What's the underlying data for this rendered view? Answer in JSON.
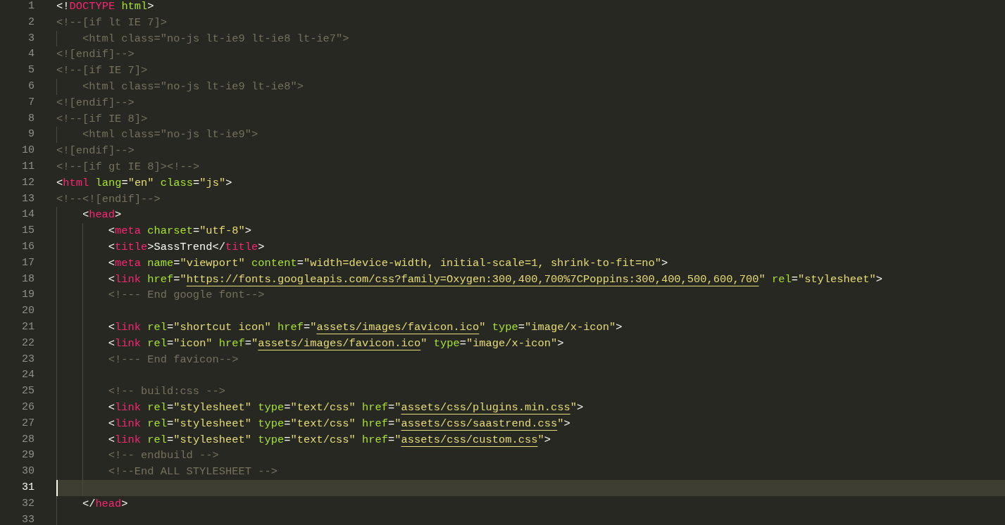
{
  "editor": {
    "lines": [
      {
        "number": "1",
        "current": false,
        "tokens": [
          {
            "kind": "p",
            "text": "<!"
          },
          {
            "kind": "tag",
            "text": "DOCTYPE"
          },
          {
            "kind": "attr",
            "text": " html"
          },
          {
            "kind": "p",
            "text": ">"
          }
        ]
      },
      {
        "number": "2",
        "current": false,
        "tokens": [
          {
            "kind": "cmt",
            "text": "<!--[if lt IE 7]>"
          }
        ],
        "children": [
          {
            "number": "3",
            "current": false,
            "tokens": [
              {
                "kind": "cmt",
                "text": "<html class=\"no-js lt-ie9 lt-ie8 lt-ie7\">"
              }
            ]
          }
        ]
      },
      {
        "number": "4",
        "current": false,
        "tokens": [
          {
            "kind": "cmt",
            "text": "<![endif]-->"
          }
        ]
      },
      {
        "number": "5",
        "current": false,
        "tokens": [
          {
            "kind": "cmt",
            "text": "<!--[if IE 7]>"
          }
        ],
        "children": [
          {
            "number": "6",
            "current": false,
            "tokens": [
              {
                "kind": "cmt",
                "text": "<html class=\"no-js lt-ie9 lt-ie8\">"
              }
            ]
          }
        ]
      },
      {
        "number": "7",
        "current": false,
        "tokens": [
          {
            "kind": "cmt",
            "text": "<![endif]-->"
          }
        ]
      },
      {
        "number": "8",
        "current": false,
        "tokens": [
          {
            "kind": "cmt",
            "text": "<!--[if IE 8]>"
          }
        ],
        "children": [
          {
            "number": "9",
            "current": false,
            "tokens": [
              {
                "kind": "cmt",
                "text": "<html class=\"no-js lt-ie9\">"
              }
            ]
          }
        ]
      },
      {
        "number": "10",
        "current": false,
        "tokens": [
          {
            "kind": "cmt",
            "text": "<![endif]-->"
          }
        ]
      },
      {
        "number": "11",
        "current": false,
        "tokens": [
          {
            "kind": "cmt",
            "text": "<!--[if gt IE 8]><!-->"
          }
        ]
      },
      {
        "number": "12",
        "current": false,
        "tokens": [
          {
            "kind": "p",
            "text": "<"
          },
          {
            "kind": "tag",
            "text": "html"
          },
          {
            "kind": "attr",
            "text": " lang"
          },
          {
            "kind": "p",
            "text": "="
          },
          {
            "kind": "str",
            "text": "\"en\""
          },
          {
            "kind": "attr",
            "text": " class"
          },
          {
            "kind": "p",
            "text": "="
          },
          {
            "kind": "str",
            "text": "\"js\""
          },
          {
            "kind": "p",
            "text": ">"
          }
        ]
      },
      {
        "number": "13",
        "current": false,
        "tokens": [
          {
            "kind": "cmt",
            "text": "<!--<![endif]-->"
          }
        ],
        "children": [
          {
            "number": "14",
            "current": false,
            "tokens": [
              {
                "kind": "p",
                "text": "<"
              },
              {
                "kind": "tag",
                "text": "head"
              },
              {
                "kind": "p",
                "text": ">"
              }
            ],
            "children": [
              {
                "number": "15",
                "current": false,
                "tokens": [
                  {
                    "kind": "p",
                    "text": "<"
                  },
                  {
                    "kind": "tag",
                    "text": "meta"
                  },
                  {
                    "kind": "attr",
                    "text": " charset"
                  },
                  {
                    "kind": "p",
                    "text": "="
                  },
                  {
                    "kind": "str",
                    "text": "\"utf-8\""
                  },
                  {
                    "kind": "p",
                    "text": ">"
                  }
                ]
              },
              {
                "number": "16",
                "current": false,
                "tokens": [
                  {
                    "kind": "p",
                    "text": "<"
                  },
                  {
                    "kind": "tag",
                    "text": "title"
                  },
                  {
                    "kind": "p",
                    "text": ">SassTrend</"
                  },
                  {
                    "kind": "tag",
                    "text": "title"
                  },
                  {
                    "kind": "p",
                    "text": ">"
                  }
                ]
              },
              {
                "number": "17",
                "current": false,
                "tokens": [
                  {
                    "kind": "p",
                    "text": "<"
                  },
                  {
                    "kind": "tag",
                    "text": "meta"
                  },
                  {
                    "kind": "attr",
                    "text": " name"
                  },
                  {
                    "kind": "p",
                    "text": "="
                  },
                  {
                    "kind": "str",
                    "text": "\"viewport\""
                  },
                  {
                    "kind": "attr",
                    "text": " content"
                  },
                  {
                    "kind": "p",
                    "text": "="
                  },
                  {
                    "kind": "str",
                    "text": "\"width=device-width, initial-scale=1, shrink-to-fit=no\""
                  },
                  {
                    "kind": "p",
                    "text": ">"
                  }
                ]
              },
              {
                "number": "18",
                "current": false,
                "tokens": [
                  {
                    "kind": "p",
                    "text": "<"
                  },
                  {
                    "kind": "tag",
                    "text": "link"
                  },
                  {
                    "kind": "attr",
                    "text": " href"
                  },
                  {
                    "kind": "p",
                    "text": "="
                  },
                  {
                    "kind": "str",
                    "text": "\""
                  },
                  {
                    "kind": "url",
                    "text": "https://fonts.googleapis.com/css?family=Oxygen:300,400,700%7CPoppins:300,400,500,600,700"
                  },
                  {
                    "kind": "str",
                    "text": "\""
                  },
                  {
                    "kind": "attr",
                    "text": " rel"
                  },
                  {
                    "kind": "p",
                    "text": "="
                  },
                  {
                    "kind": "str",
                    "text": "\"stylesheet\""
                  },
                  {
                    "kind": "p",
                    "text": ">"
                  }
                ]
              },
              {
                "number": "19",
                "current": false,
                "tokens": [
                  {
                    "kind": "cmt",
                    "text": "<!--- End google font-->"
                  }
                ]
              },
              {
                "number": "20",
                "current": false
              },
              {
                "number": "21",
                "current": false,
                "tokens": [
                  {
                    "kind": "p",
                    "text": "<"
                  },
                  {
                    "kind": "tag",
                    "text": "link"
                  },
                  {
                    "kind": "attr",
                    "text": " rel"
                  },
                  {
                    "kind": "p",
                    "text": "="
                  },
                  {
                    "kind": "str",
                    "text": "\"shortcut icon\""
                  },
                  {
                    "kind": "attr",
                    "text": " href"
                  },
                  {
                    "kind": "p",
                    "text": "="
                  },
                  {
                    "kind": "str",
                    "text": "\""
                  },
                  {
                    "kind": "url",
                    "text": "assets/images/favicon.ico"
                  },
                  {
                    "kind": "str",
                    "text": "\""
                  },
                  {
                    "kind": "attr",
                    "text": " type"
                  },
                  {
                    "kind": "p",
                    "text": "="
                  },
                  {
                    "kind": "str",
                    "text": "\"image/x-icon\""
                  },
                  {
                    "kind": "p",
                    "text": ">"
                  }
                ]
              },
              {
                "number": "22",
                "current": false,
                "tokens": [
                  {
                    "kind": "p",
                    "text": "<"
                  },
                  {
                    "kind": "tag",
                    "text": "link"
                  },
                  {
                    "kind": "attr",
                    "text": " rel"
                  },
                  {
                    "kind": "p",
                    "text": "="
                  },
                  {
                    "kind": "str",
                    "text": "\"icon\""
                  },
                  {
                    "kind": "attr",
                    "text": " href"
                  },
                  {
                    "kind": "p",
                    "text": "="
                  },
                  {
                    "kind": "str",
                    "text": "\""
                  },
                  {
                    "kind": "url",
                    "text": "assets/images/favicon.ico"
                  },
                  {
                    "kind": "str",
                    "text": "\""
                  },
                  {
                    "kind": "attr",
                    "text": " type"
                  },
                  {
                    "kind": "p",
                    "text": "="
                  },
                  {
                    "kind": "str",
                    "text": "\"image/x-icon\""
                  },
                  {
                    "kind": "p",
                    "text": ">"
                  }
                ]
              },
              {
                "number": "23",
                "current": false,
                "tokens": [
                  {
                    "kind": "cmt",
                    "text": "<!--- End favicon-->"
                  }
                ]
              },
              {
                "number": "24",
                "current": false
              },
              {
                "number": "25",
                "current": false,
                "tokens": [
                  {
                    "kind": "cmt",
                    "text": "<!-- build:css -->"
                  }
                ]
              },
              {
                "number": "26",
                "current": false,
                "tokens": [
                  {
                    "kind": "p",
                    "text": "<"
                  },
                  {
                    "kind": "tag",
                    "text": "link"
                  },
                  {
                    "kind": "attr",
                    "text": " rel"
                  },
                  {
                    "kind": "p",
                    "text": "="
                  },
                  {
                    "kind": "str",
                    "text": "\"stylesheet\""
                  },
                  {
                    "kind": "attr",
                    "text": " type"
                  },
                  {
                    "kind": "p",
                    "text": "="
                  },
                  {
                    "kind": "str",
                    "text": "\"text/css\""
                  },
                  {
                    "kind": "attr",
                    "text": " href"
                  },
                  {
                    "kind": "p",
                    "text": "="
                  },
                  {
                    "kind": "str",
                    "text": "\""
                  },
                  {
                    "kind": "url",
                    "text": "assets/css/plugins.min.css"
                  },
                  {
                    "kind": "str",
                    "text": "\""
                  },
                  {
                    "kind": "p",
                    "text": ">"
                  }
                ]
              },
              {
                "number": "27",
                "current": false,
                "tokens": [
                  {
                    "kind": "p",
                    "text": "<"
                  },
                  {
                    "kind": "tag",
                    "text": "link"
                  },
                  {
                    "kind": "attr",
                    "text": " rel"
                  },
                  {
                    "kind": "p",
                    "text": "="
                  },
                  {
                    "kind": "str",
                    "text": "\"stylesheet\""
                  },
                  {
                    "kind": "attr",
                    "text": " type"
                  },
                  {
                    "kind": "p",
                    "text": "="
                  },
                  {
                    "kind": "str",
                    "text": "\"text/css\""
                  },
                  {
                    "kind": "attr",
                    "text": " href"
                  },
                  {
                    "kind": "p",
                    "text": "="
                  },
                  {
                    "kind": "str",
                    "text": "\""
                  },
                  {
                    "kind": "url",
                    "text": "assets/css/saastrend.css"
                  },
                  {
                    "kind": "str",
                    "text": "\""
                  },
                  {
                    "kind": "p",
                    "text": ">"
                  }
                ]
              },
              {
                "number": "28",
                "current": false,
                "tokens": [
                  {
                    "kind": "p",
                    "text": "<"
                  },
                  {
                    "kind": "tag",
                    "text": "link"
                  },
                  {
                    "kind": "attr",
                    "text": " rel"
                  },
                  {
                    "kind": "p",
                    "text": "="
                  },
                  {
                    "kind": "str",
                    "text": "\"stylesheet\""
                  },
                  {
                    "kind": "attr",
                    "text": " type"
                  },
                  {
                    "kind": "p",
                    "text": "="
                  },
                  {
                    "kind": "str",
                    "text": "\"text/css\""
                  },
                  {
                    "kind": "attr",
                    "text": " href"
                  },
                  {
                    "kind": "p",
                    "text": "="
                  },
                  {
                    "kind": "str",
                    "text": "\""
                  },
                  {
                    "kind": "url",
                    "text": "assets/css/custom.css"
                  },
                  {
                    "kind": "str",
                    "text": "\""
                  },
                  {
                    "kind": "p",
                    "text": ">"
                  }
                ]
              },
              {
                "number": "29",
                "current": false,
                "tokens": [
                  {
                    "kind": "cmt",
                    "text": "<!-- endbuild -->"
                  }
                ]
              },
              {
                "number": "30",
                "current": false,
                "tokens": [
                  {
                    "kind": "cmt",
                    "text": "<!--End ALL STYLESHEET -->"
                  }
                ]
              },
              {
                "number": "31",
                "current": true
              }
            ]
          },
          {
            "number": "32",
            "current": false,
            "tokens": [
              {
                "kind": "p",
                "text": "</"
              },
              {
                "kind": "tag",
                "text": "head"
              },
              {
                "kind": "p",
                "text": ">"
              }
            ]
          },
          {
            "number": "33",
            "current": false
          }
        ]
      }
    ]
  }
}
